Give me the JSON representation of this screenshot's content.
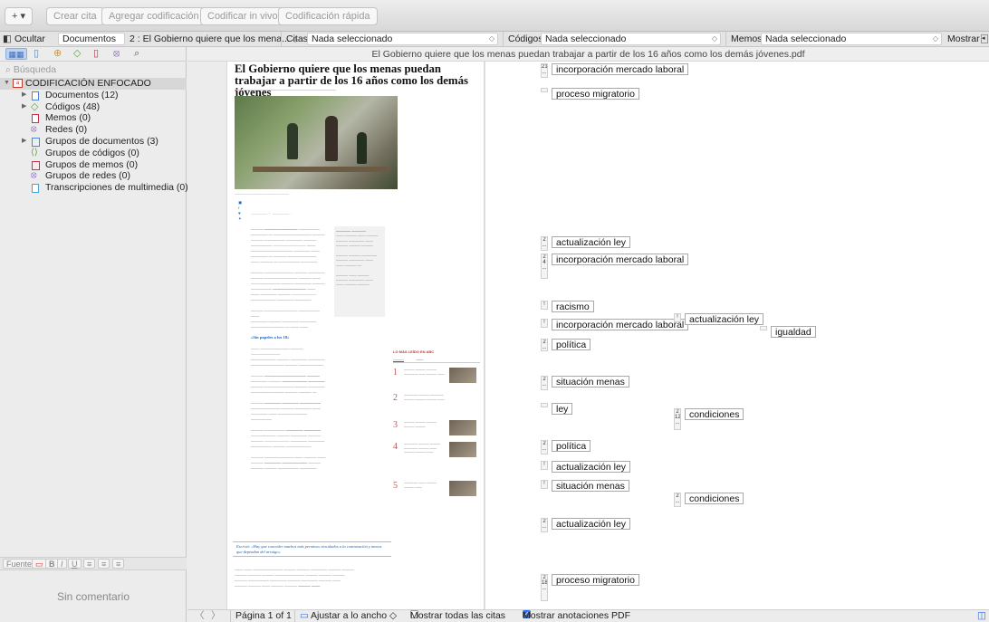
{
  "toolbar": {
    "new_label": "+ ▾",
    "crear_cita": "Crear cita",
    "agregar_codificacion": "Agregar codificación",
    "codificar_in_vivo": "Codificar in vivo",
    "codificacion_rapida": "Codificación rápida"
  },
  "filterbar": {
    "ocultar": "Ocultar",
    "documentos_label": "Documentos",
    "documento_sel": "2 : El Gobierno quiere que los mena...",
    "citas_label": "Citas",
    "citas_value": "Nada seleccionado",
    "codigos_label": "Códigos",
    "codigos_value": "Nada seleccionado",
    "memos_label": "Memos",
    "memos_value": "Nada seleccionado",
    "mostrar": "Mostrar"
  },
  "sidebar": {
    "search_placeholder": "Búsqueda",
    "root": "CODIFICACIÓN ENFOCADO",
    "items": [
      {
        "label": "Documentos (12)"
      },
      {
        "label": "Códigos (48)"
      },
      {
        "label": "Memos (0)"
      },
      {
        "label": "Redes (0)"
      },
      {
        "label": "Grupos de documentos (3)"
      },
      {
        "label": "Grupos de códigos (0)"
      },
      {
        "label": "Grupos de memos (0)"
      },
      {
        "label": "Grupos de redes (0)"
      },
      {
        "label": "Transcripciones de multimedia (0)"
      }
    ],
    "fuentes": "Fuentes",
    "no_comment": "Sin comentario"
  },
  "document": {
    "file_title": "El Gobierno quiere que los menas puedan trabajar a partir de los 16 años como los demás jóvenes.pdf",
    "headline": "El Gobierno quiere que los menas puedan trabajar a partir de los 16 años como los demás jóvenes",
    "pullquote": "Escrivá: «Hay que conceder muchos más permisos vinculados a la contratación y menos que dependan del arraigo»",
    "section_head": "«Sin papeles a los 18»",
    "most_read": "LO MÁS LEÍDO EN ABC"
  },
  "margin_codes": [
    {
      "label": "incorporación mercado laboral",
      "marker": "21 ..."
    },
    {
      "label": "proceso migratorio",
      "marker": "..."
    },
    {
      "label": "actualización ley",
      "marker": "2 ..."
    },
    {
      "label": "incorporación mercado laboral",
      "marker": "2 4 ..."
    },
    {
      "label": "racismo",
      "marker": "!"
    },
    {
      "label": "incorporación mercado laboral",
      "marker": "!"
    },
    {
      "label": "actualización ley",
      "marker": "!"
    },
    {
      "label": "igualdad",
      "marker": "..."
    },
    {
      "label": "política",
      "marker": "2 ..."
    },
    {
      "label": "situación menas",
      "marker": "2 ..."
    },
    {
      "label": "ley",
      "marker": "..."
    },
    {
      "label": "condiciones",
      "marker": "2 12 ..."
    },
    {
      "label": "política",
      "marker": "2 ..."
    },
    {
      "label": "actualización ley",
      "marker": "!"
    },
    {
      "label": "situación menas",
      "marker": "!"
    },
    {
      "label": "condiciones",
      "marker": "2 ..."
    },
    {
      "label": "actualización ley",
      "marker": "2 ..."
    },
    {
      "label": "proceso migratorio",
      "marker": "2 18 ..."
    }
  ],
  "statusbar": {
    "page": "Página 1 of 1",
    "fit": "Ajustar a lo ancho ◇",
    "show_all": "Mostrar todas las citas",
    "show_pdf": "Mostrar anotaciones PDF"
  },
  "colors": {
    "accent": "#2a6ee8",
    "link": "#1b66c9",
    "red": "#c33333"
  }
}
